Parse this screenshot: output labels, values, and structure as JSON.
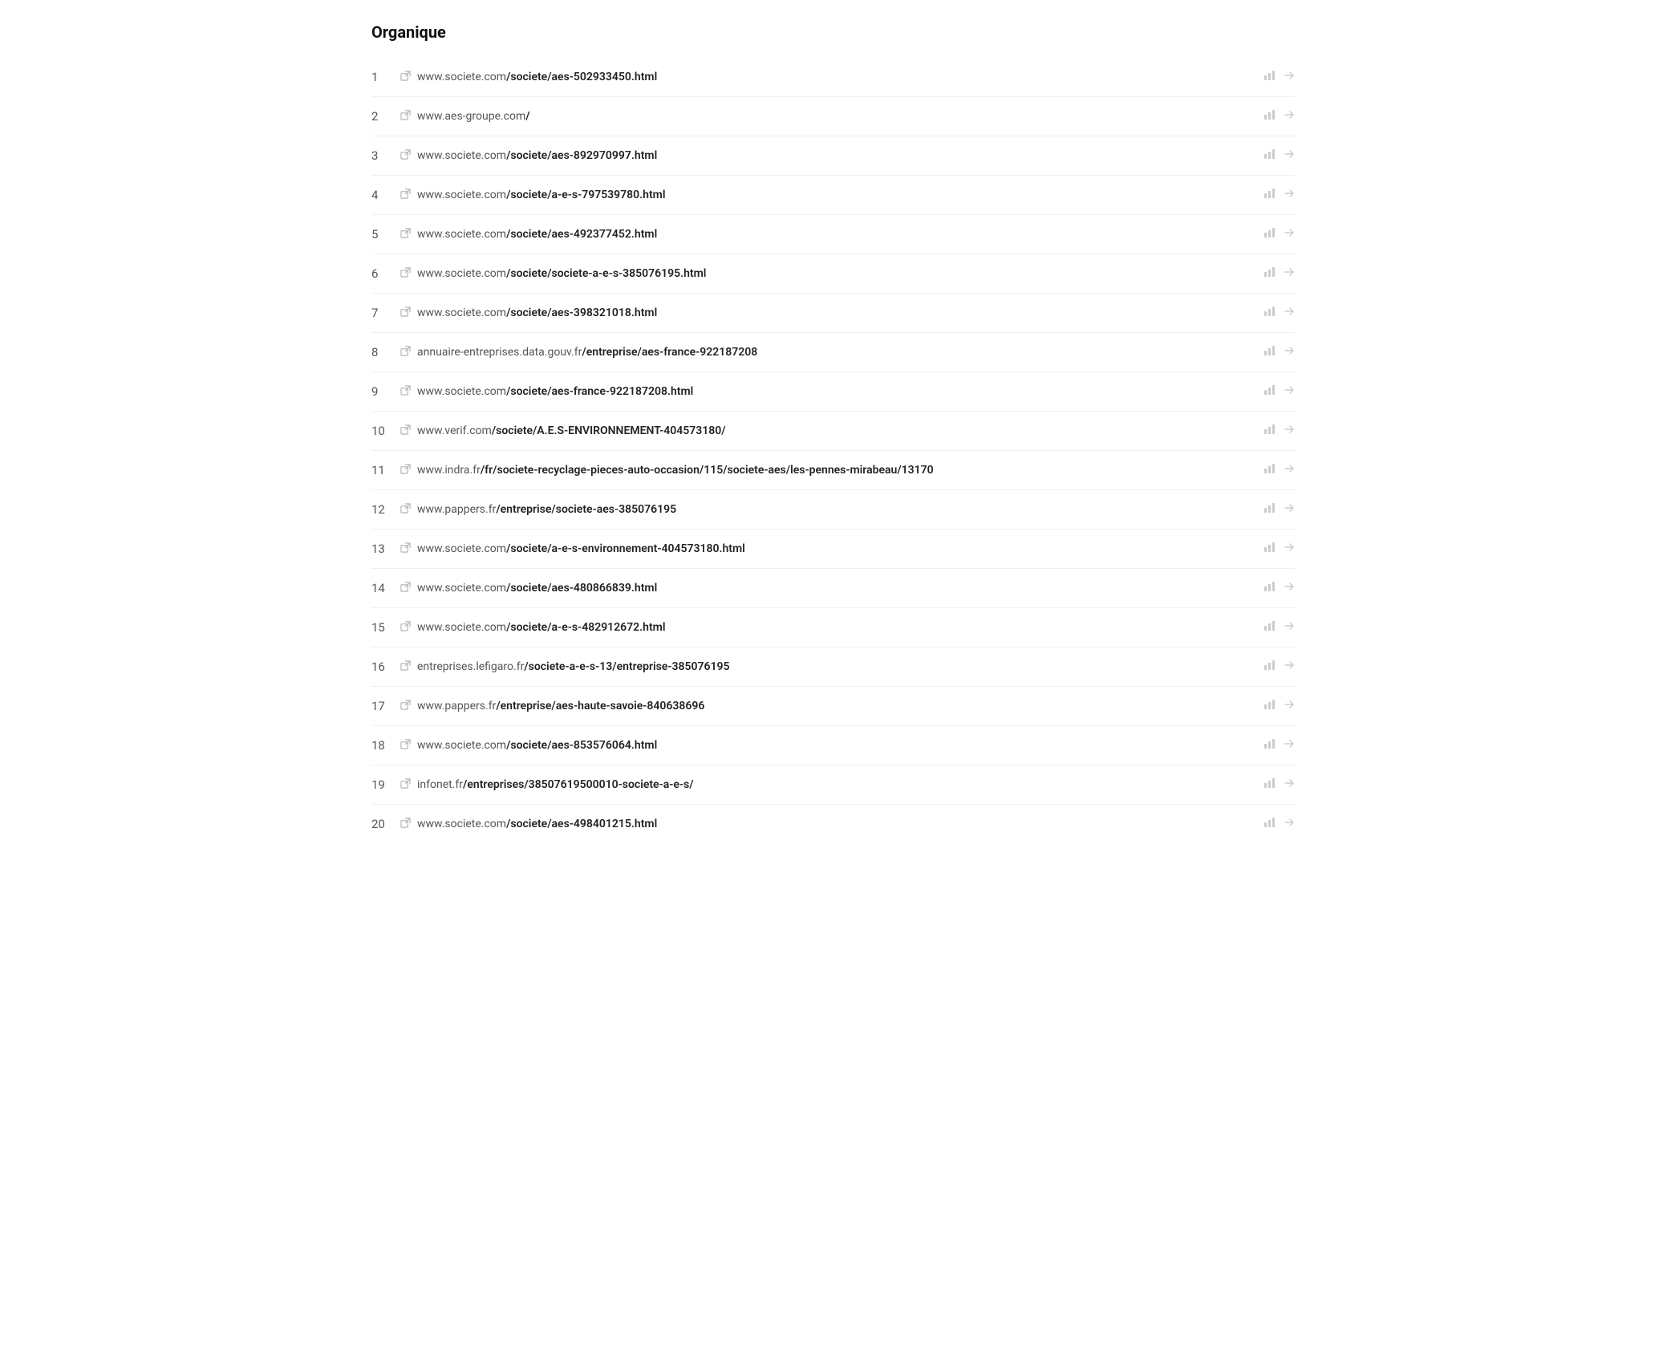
{
  "section": {
    "title": "Organique"
  },
  "results": [
    {
      "rank": 1,
      "url_prefix": "www.societe.com",
      "url_suffix": "/societe/aes-502933450.html"
    },
    {
      "rank": 2,
      "url_prefix": "www.aes-groupe.com",
      "url_suffix": "/"
    },
    {
      "rank": 3,
      "url_prefix": "www.societe.com",
      "url_suffix": "/societe/aes-892970997.html"
    },
    {
      "rank": 4,
      "url_prefix": "www.societe.com",
      "url_suffix": "/societe/a-e-s-797539780.html"
    },
    {
      "rank": 5,
      "url_prefix": "www.societe.com",
      "url_suffix": "/societe/aes-492377452.html"
    },
    {
      "rank": 6,
      "url_prefix": "www.societe.com",
      "url_suffix": "/societe/societe-a-e-s-385076195.html"
    },
    {
      "rank": 7,
      "url_prefix": "www.societe.com",
      "url_suffix": "/societe/aes-398321018.html"
    },
    {
      "rank": 8,
      "url_prefix": "annuaire-entreprises.data.gouv.fr",
      "url_suffix": "/entreprise/aes-france-922187208"
    },
    {
      "rank": 9,
      "url_prefix": "www.societe.com",
      "url_suffix": "/societe/aes-france-922187208.html"
    },
    {
      "rank": 10,
      "url_prefix": "www.verif.com",
      "url_suffix": "/societe/A.E.S-ENVIRONNEMENT-404573180/"
    },
    {
      "rank": 11,
      "url_prefix": "www.indra.fr",
      "url_suffix": "/fr/societe-recyclage-pieces-auto-occasion/115/societe-aes/les-pennes-mirabeau/13170"
    },
    {
      "rank": 12,
      "url_prefix": "www.pappers.fr",
      "url_suffix": "/entreprise/societe-aes-385076195"
    },
    {
      "rank": 13,
      "url_prefix": "www.societe.com",
      "url_suffix": "/societe/a-e-s-environnement-404573180.html"
    },
    {
      "rank": 14,
      "url_prefix": "www.societe.com",
      "url_suffix": "/societe/aes-480866839.html"
    },
    {
      "rank": 15,
      "url_prefix": "www.societe.com",
      "url_suffix": "/societe/a-e-s-482912672.html"
    },
    {
      "rank": 16,
      "url_prefix": "entreprises.lefigaro.fr",
      "url_suffix": "/societe-a-e-s-13/entreprise-385076195"
    },
    {
      "rank": 17,
      "url_prefix": "www.pappers.fr",
      "url_suffix": "/entreprise/aes-haute-savoie-840638696"
    },
    {
      "rank": 18,
      "url_prefix": "www.societe.com",
      "url_suffix": "/societe/aes-853576064.html"
    },
    {
      "rank": 19,
      "url_prefix": "infonet.fr",
      "url_suffix": "/entreprises/38507619500010-societe-a-e-s/"
    },
    {
      "rank": 20,
      "url_prefix": "www.societe.com",
      "url_suffix": "/societe/aes-498401215.html"
    }
  ],
  "icons": {
    "external": "↗",
    "chart": "📊",
    "arrow": "→"
  }
}
